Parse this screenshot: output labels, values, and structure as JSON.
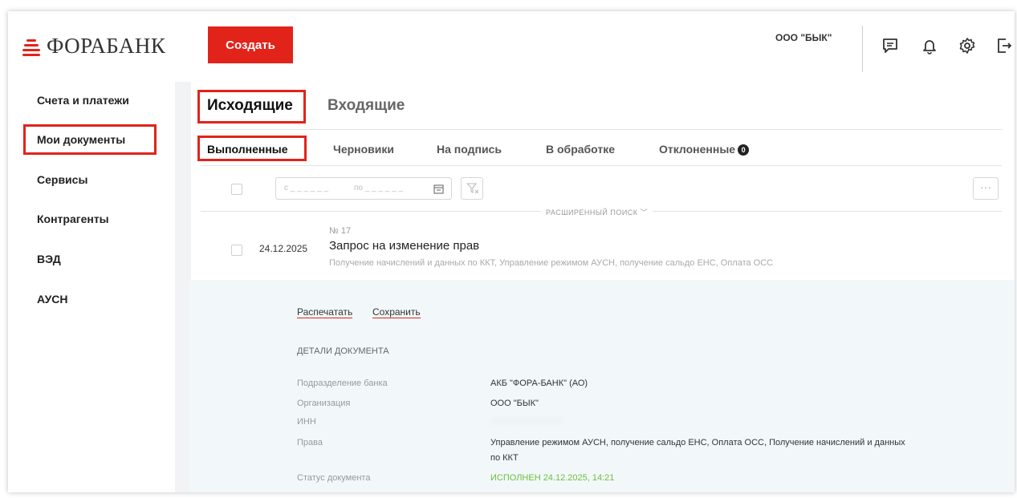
{
  "header": {
    "logo_text": "ФОРАБАНК",
    "create_label": "Создать",
    "org_name": "ООО \"БЫК\""
  },
  "header_icons": [
    "chat-icon",
    "bell-icon",
    "gear-icon",
    "logout-icon"
  ],
  "sidebar": {
    "items": [
      {
        "label": "Счета и платежи"
      },
      {
        "label": "Мои документы"
      },
      {
        "label": "Сервисы"
      },
      {
        "label": "Контрагенты"
      },
      {
        "label": "ВЭД"
      },
      {
        "label": "АУСН"
      }
    ],
    "active": "Мои документы"
  },
  "tabs": {
    "outgoing": "Исходящие",
    "incoming": "Входящие"
  },
  "subtabs": {
    "done": "Выполненные",
    "drafts": "Черновики",
    "to_sign": "На подпись",
    "processing": "В обработке",
    "rejected": "Отклоненные",
    "rejected_count": "0"
  },
  "filters": {
    "date_from": "с _ _ _ _ _ _",
    "date_to": "по _ _ _ _ _ _",
    "advanced_search": "РАСШИРЕННЫЙ ПОИСК",
    "more": "···"
  },
  "document": {
    "number": "№ 17",
    "date": "24.12.2025",
    "title": "Запрос на изменение прав",
    "subtitle": "Получение начислений и данных по ККТ, Управление режимом АУСН, получение сальдо ЕНС, Оплата ОСС"
  },
  "details": {
    "print_label": "Распечатать",
    "save_label": "Сохранить",
    "heading": "ДЕТАЛИ ДОКУМЕНТА",
    "rows": [
      {
        "label": "Подразделение банка",
        "value": "АКБ \"ФОРА-БАНК\" (АО)"
      },
      {
        "label": "Организация",
        "value": "ООО \"БЫК\""
      },
      {
        "label": "ИНН",
        "value": ""
      },
      {
        "label": "Права",
        "value": "Управление режимом АУСН, получение сальдо ЕНС, Оплата ОСС, Получение начислений и данных",
        "value_line2": "по ККТ"
      },
      {
        "label": "Статус документа",
        "value": "ИСПОЛНЕН 24.12.2025, 14:21"
      }
    ]
  },
  "colors": {
    "accent": "#e2231a",
    "status_ok": "#6cbf3a",
    "details_bg": "#f2f8fa"
  }
}
